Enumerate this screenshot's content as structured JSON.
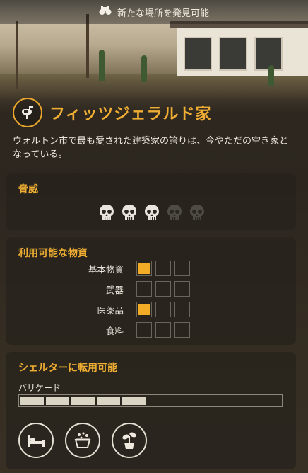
{
  "topbar": {
    "text": "新たな場所を発見可能",
    "icon": "binoculars-icon"
  },
  "location": {
    "title": "フィッツジェラルド家",
    "icon": "mailbox-icon",
    "description": "ウォルトン市で最も愛された建築家の誇りは、今やただの空き家となっている。"
  },
  "threat": {
    "title": "脅威",
    "level": 3,
    "max": 5,
    "active_color": "#e9e5dc",
    "inactive_color": "#4e4a44"
  },
  "resources": {
    "title": "利用可能な物資",
    "accent_color": "#f2ac25",
    "rows": [
      {
        "label": "基本物資",
        "level": 1,
        "max": 3
      },
      {
        "label": "武器",
        "level": 0,
        "max": 3
      },
      {
        "label": "医薬品",
        "level": 1,
        "max": 3
      },
      {
        "label": "食料",
        "level": 0,
        "max": 3
      }
    ]
  },
  "shelter": {
    "title": "シェルターに転用可能",
    "barricade_label": "バリケード",
    "barricade_level": 5,
    "barricade_max": 10,
    "features": [
      "bed-icon",
      "washtub-icon",
      "plant-pot-icon"
    ]
  }
}
